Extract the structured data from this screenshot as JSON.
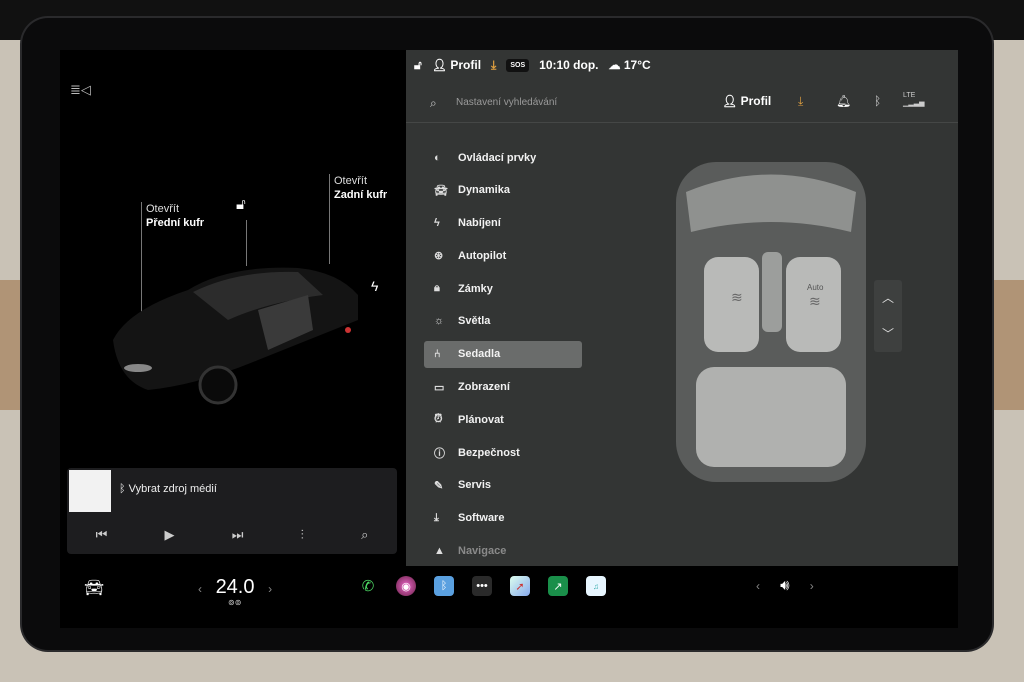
{
  "status_bar": {
    "profile": "Profil",
    "sos": "SOS",
    "time": "10:10 dop.",
    "weather_temp": "17°C"
  },
  "search": {
    "placeholder": "Nastavení vyhledávání",
    "profile": "Profil"
  },
  "callouts": {
    "front": {
      "action": "Otevřít",
      "target": "Přední kufr"
    },
    "rear": {
      "action": "Otevřít",
      "target": "Zadní kufr"
    }
  },
  "media": {
    "source_label": "Vybrat zdroj médií"
  },
  "menu": [
    {
      "label": "Ovládací prvky",
      "icon": "toggle-icon"
    },
    {
      "label": "Dynamika",
      "icon": "car-icon"
    },
    {
      "label": "Nabíjení",
      "icon": "bolt-icon"
    },
    {
      "label": "Autopilot",
      "icon": "steering-wheel-icon"
    },
    {
      "label": "Zámky",
      "icon": "lock-icon"
    },
    {
      "label": "Světla",
      "icon": "sun-icon"
    },
    {
      "label": "Sedadla",
      "icon": "seat-icon",
      "active": true
    },
    {
      "label": "Zobrazení",
      "icon": "display-icon"
    },
    {
      "label": "Plánovat",
      "icon": "alarm-clock-icon"
    },
    {
      "label": "Bezpečnost",
      "icon": "alert-icon"
    },
    {
      "label": "Servis",
      "icon": "wrench-icon"
    },
    {
      "label": "Software",
      "icon": "download-icon"
    },
    {
      "label": "Navigace",
      "icon": "navigation-icon"
    }
  ],
  "seats": {
    "auto_label": "Auto"
  },
  "climate": {
    "temperature": "24.0"
  },
  "lte": "LTE",
  "colors": {
    "accent_download": "#e0a040",
    "panel_bg": "#333534",
    "active_item": "#6a6c6b"
  }
}
